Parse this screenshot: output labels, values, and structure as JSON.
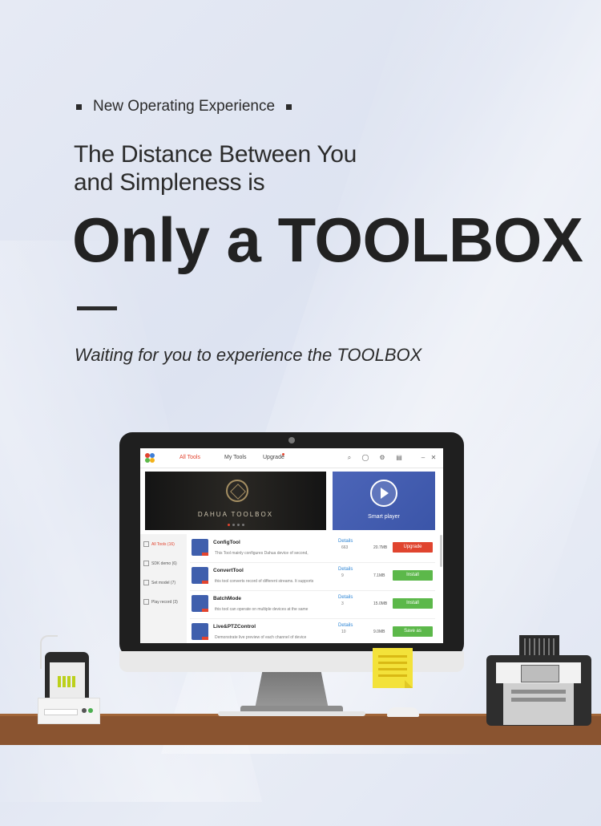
{
  "header": {
    "kicker": "New Operating Experience",
    "line1": "The Distance Between You",
    "line2": "and Simpleness is",
    "headline": "Only a TOOLBOX",
    "tagline": "Waiting for you to experience the TOOLBOX"
  },
  "app": {
    "tabs": [
      "All Tools",
      "My Tools",
      "Upgrade"
    ],
    "banner_main": "DAHUA TOOLBOX",
    "banner_side": "Smart player",
    "sidebar": [
      "All Tools (16)",
      "SDK demo (6)",
      "Set model (7)",
      "Play record (3)"
    ],
    "tools": [
      {
        "name": "ConfigTool",
        "desc": "This Tool mainly configures Dahua device of second,",
        "details": "Details",
        "count": "663",
        "size": "20.7MB",
        "action": "Upgrade"
      },
      {
        "name": "ConvertTool",
        "desc": "this tool converts record of different streams. It supports",
        "details": "Details",
        "count": "9",
        "size": "7.1MB",
        "action": "Install"
      },
      {
        "name": "BatchMode",
        "desc": "this tool can operate on multiple devices at the same",
        "details": "Details",
        "count": "3",
        "size": "15.0MB",
        "action": "Install"
      },
      {
        "name": "Live&PTZControl",
        "desc": "Demonstrate live preview of each channel of device",
        "details": "Details",
        "count": "10",
        "size": "9.0MB",
        "action": "Save as"
      }
    ]
  },
  "colors": {
    "accent": "#e2442f",
    "install": "#5cb84a",
    "link": "#2f86d6",
    "desk": "#8a5430"
  }
}
